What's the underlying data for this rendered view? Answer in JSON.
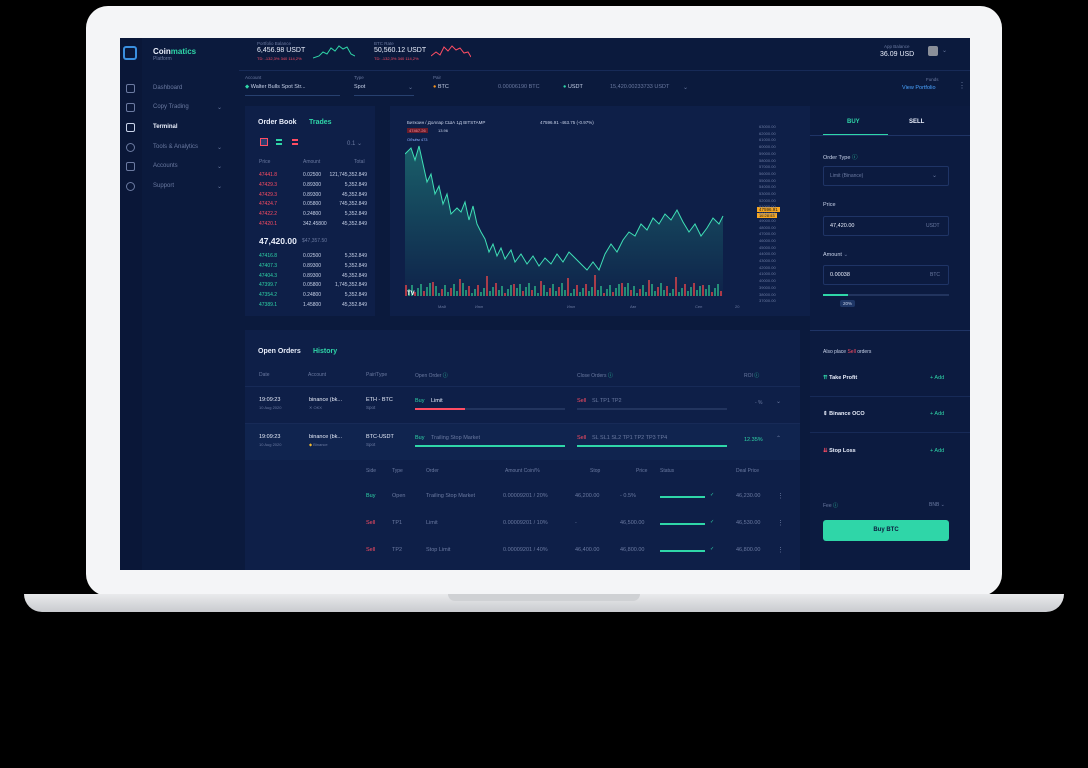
{
  "brand": {
    "name_a": "Coin",
    "name_b": "matics",
    "sub": "Platform"
  },
  "sidebar": {
    "items": [
      {
        "label": "Dashboard"
      },
      {
        "label": "Copy Trading"
      },
      {
        "label": "Terminal"
      },
      {
        "label": "Tools & Analytics"
      },
      {
        "label": "Accounts"
      },
      {
        "label": "Support"
      }
    ]
  },
  "header": {
    "portfolio": {
      "label": "Portfolio Balance",
      "value": "6,456.98 USDT",
      "change": "TD: -132,3% 340 114,2%"
    },
    "btc": {
      "label": "BTC Rate",
      "value": "50,560.12 USDT",
      "change": "TD: -132,3% 340 114,2%"
    },
    "app_balance": {
      "label": "App Balance",
      "value": "36.09 USD"
    }
  },
  "toolbar": {
    "account_label": "Account",
    "account": "Walter Bulls Spot Str...",
    "type_label": "Type",
    "type": "Spot",
    "pair_label": "Pair",
    "base": "BTC",
    "base_val": "0.00006190 BTC",
    "quote": "USDT",
    "quote_val": "15,420.00233733 USDT",
    "funds_label": "Funds",
    "funds_link": "View Portfolio"
  },
  "orderbook": {
    "title": "Order Book",
    "tab2": "Trades",
    "step": "0.1",
    "headers": [
      "Price",
      "Amount",
      "Total"
    ],
    "asks": [
      [
        "47441.8",
        "0.02500",
        "121,745,352.849"
      ],
      [
        "47429.3",
        "0.89300",
        "5,352.849"
      ],
      [
        "47429.3",
        "0.89300",
        "45,352.849"
      ],
      [
        "47424.7",
        "0.05800",
        "745,352.849"
      ],
      [
        "47422.2",
        "0.24800",
        "5,352.849"
      ],
      [
        "47420.1",
        "342.45800",
        "45,352.849"
      ]
    ],
    "mid": "47,420.00",
    "mid_sub": "$47,357.50",
    "bids": [
      [
        "47416.8",
        "0.02500",
        "5,352.849"
      ],
      [
        "47407.3",
        "0.89300",
        "5,352.849"
      ],
      [
        "47404.3",
        "0.89300",
        "45,352.849"
      ],
      [
        "47399.7",
        "0.05800",
        "1,745,352.849"
      ],
      [
        "47354.2",
        "0.24800",
        "5,352.849"
      ],
      [
        "47389.1",
        "1.45800",
        "45,352.849"
      ]
    ]
  },
  "chart": {
    "header": "Биткоин / Доллар США  1Д  BITSTAMP",
    "ohlc": "47596.91  -463.75 (-0.97%)",
    "sell_tag": "47467.26",
    "buy_tag": "13.96",
    "volume": "Объём  473",
    "y_ticks": [
      "63000.00",
      "62000.00",
      "61000.00",
      "60000.00",
      "59000.00",
      "58000.00",
      "57000.00",
      "56000.00",
      "55000.00",
      "54000.00",
      "53000.00",
      "52000.00",
      "51000.00",
      "50000.00",
      "49000.00",
      "48000.00",
      "47000.00",
      "46000.00",
      "45000.00",
      "44000.00",
      "43000.00",
      "42000.00",
      "41000.00",
      "40000.00",
      "39000.00",
      "38000.00",
      "37000.00"
    ],
    "x_ticks": [
      "Май",
      "Июн",
      "Июл",
      "Авг",
      "Сен",
      "20"
    ],
    "price_tag": "47596.91",
    "price_tag2": "16:28:53"
  },
  "trade": {
    "buy": "BUY",
    "sell": "SELL",
    "order_type_label": "Order Type",
    "order_type": "Limit (Binance)",
    "price_label": "Price",
    "price": "47,420.00",
    "price_unit": "USDT",
    "amount_label": "Amount",
    "amount": "0.00038",
    "amount_unit": "BTC",
    "pct": "20%",
    "also_a": "Also place ",
    "also_b": "Sell",
    "also_c": " orders",
    "tp": "Take Profit",
    "oco": "Binance OCO",
    "sl": "Stop Loss",
    "add": "+ Add",
    "fee_label": "Fee",
    "fee": "BNB",
    "buy_btn": "Buy BTC"
  },
  "orders": {
    "title": "Open Orders",
    "tab2": "History",
    "headers": [
      "Date",
      "Account",
      "Pair/Type",
      "Open Order",
      "Close Orders",
      "ROI"
    ],
    "rows": [
      {
        "time": "19:09:23",
        "date": "10 Aug 2020",
        "acct": "binance (bk...",
        "exch": "OKX",
        "pair": "ETH - BTC",
        "type": "Spot",
        "open_side": "Buy",
        "open_kind": "Limit",
        "close_side": "Sell",
        "close_tags": "SL  TP1  TP2",
        "roi": "- %"
      },
      {
        "time": "19:09:23",
        "date": "10 Aug 2020",
        "acct": "binance (bk...",
        "exch": "Binance",
        "pair": "BTC-USDT",
        "type": "Spot",
        "open_side": "Buy",
        "open_kind": "Trailing Stop Market",
        "close_side": "Sell",
        "close_tags": "SL  SL1  SL2  TP1  TP2  TP3  TP4",
        "roi": "12.35%"
      }
    ],
    "sub_headers": [
      "Side",
      "Type",
      "Order",
      "Amount Coin/%",
      "Stop",
      "Price",
      "Status",
      "Deal Price"
    ],
    "sub_rows": [
      {
        "side": "Buy",
        "type": "Open",
        "order": "Trailing Stop Market",
        "amount": "0.00009201 / 20%",
        "stop": "46,200.00",
        "price": "- 0.5%",
        "deal": "46,230.00"
      },
      {
        "side": "Sell",
        "type": "TP1",
        "order": "Limit",
        "amount": "0.00009201 / 10%",
        "stop": "-",
        "price": "46,500.00",
        "deal": "46,530.00"
      },
      {
        "side": "Sell",
        "type": "TP2",
        "order": "Stop Limit",
        "amount": "0.00009201 / 40%",
        "stop": "46,400.00",
        "price": "46,800.00",
        "deal": "46,800.00"
      }
    ]
  },
  "colors": {
    "accent": "#2fd6a8",
    "sell": "#ff4d63",
    "bg": "#0b1a3d"
  }
}
